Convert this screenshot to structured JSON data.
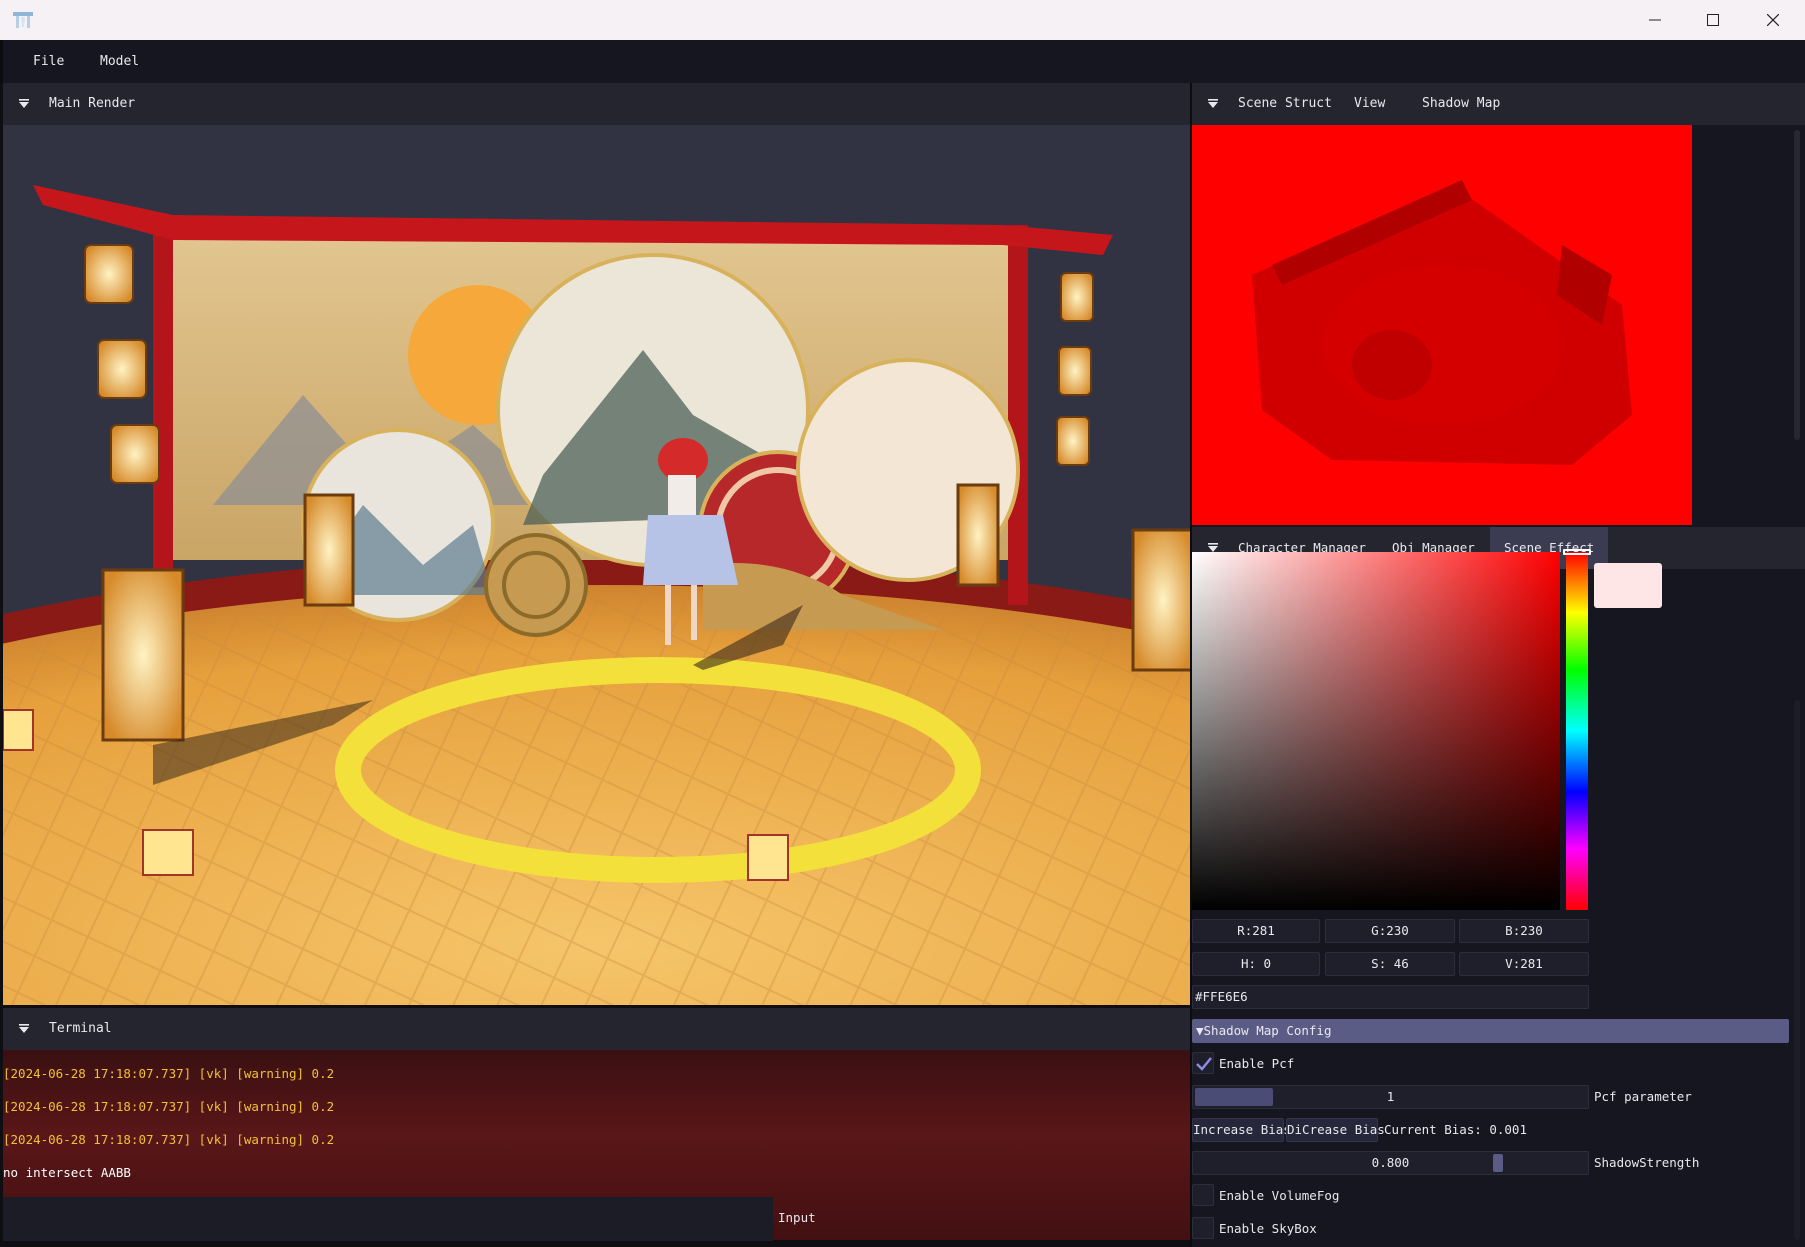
{
  "window": {
    "title": "",
    "controls": [
      "minimize",
      "maximize",
      "close"
    ]
  },
  "menu": {
    "file": "File",
    "model": "Model"
  },
  "main_render": {
    "title": "Main Render"
  },
  "terminal": {
    "title": "Terminal",
    "lines": [
      {
        "text": "[2024-06-28 17:18:07.737] [vk] [warning] 0.2",
        "color": "#f1c232"
      },
      {
        "text": "[2024-06-28 17:18:07.737] [vk] [warning] 0.2",
        "color": "#f1c232"
      },
      {
        "text": "[2024-06-28 17:18:07.737] [vk] [warning] 0.2",
        "color": "#f1c232"
      },
      {
        "text": "no intersect AABB",
        "color": "#ffffff"
      }
    ],
    "input_label": "Input"
  },
  "right_top": {
    "collapse_icon": "collapse-arrow-icon",
    "tabs": [
      "Scene Struct",
      "View",
      "Shadow Map"
    ],
    "active_tab": "Shadow Map"
  },
  "right_bottom": {
    "tabs": [
      "Character Manager",
      "Obj Manager",
      "Scene Effect"
    ],
    "active_tab": "Scene Effect"
  },
  "color_picker": {
    "hue_color": "#ff0000",
    "selected_color": "#ffe6e6",
    "r": "R:281",
    "g": "G:230",
    "b": "B:230",
    "h": "H:  0",
    "s": "S: 46",
    "v": "V:281",
    "hex": "#FFE6E6"
  },
  "shadow_map_config": {
    "header": "Shadow Map Config",
    "enable_pcf_label": "Enable Pcf",
    "enable_pcf": true,
    "pcf_value": "1",
    "pcf_label": "Pcf parameter",
    "pcf_fill_fraction": 0.2,
    "increase_bias": "Increase Bias",
    "decrease_bias": "DiCrease Bias",
    "current_bias": "Current Bias: 0.001",
    "shadow_strength_value": "0.800",
    "shadow_strength_fraction": 0.8,
    "shadow_strength_label": "ShadowStrength",
    "volume_fog_label": "Enable VolumeFog",
    "volume_fog": false,
    "skybox_label": "Enable SkyBox",
    "skybox": false
  },
  "colors": {
    "accent": "#5b5c86",
    "panel_header": "#24252f",
    "panel_bg": "#15161f",
    "warning_text": "#f1c232"
  }
}
